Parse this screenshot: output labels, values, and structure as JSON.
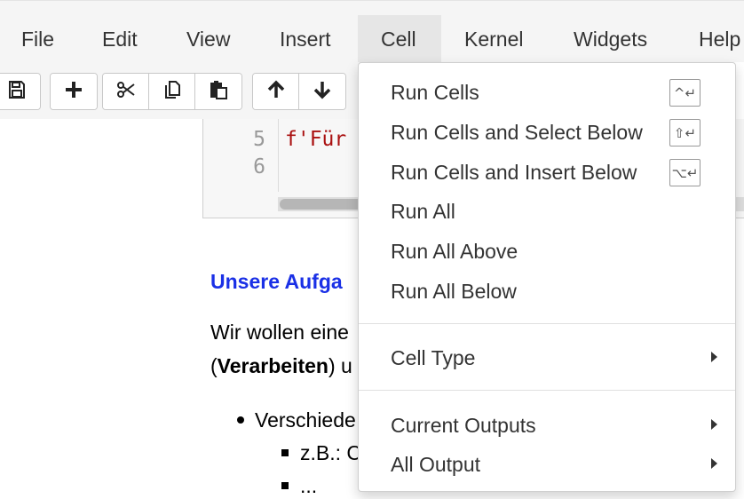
{
  "menubar": {
    "items": [
      {
        "label": "File"
      },
      {
        "label": "Edit"
      },
      {
        "label": "View"
      },
      {
        "label": "Insert"
      },
      {
        "label": "Cell"
      },
      {
        "label": "Kernel"
      },
      {
        "label": "Widgets"
      },
      {
        "label": "Help"
      }
    ],
    "active_item": "Cell"
  },
  "toolbar": {
    "buttons": [
      {
        "icon": "save-icon"
      },
      {
        "icon": "plus-icon"
      },
      {
        "icon": "scissors-icon"
      },
      {
        "icon": "copy-icon"
      },
      {
        "icon": "paste-icon"
      },
      {
        "icon": "arrow-up-icon"
      },
      {
        "icon": "arrow-down-icon"
      }
    ]
  },
  "code_cell": {
    "line_numbers": [
      "5",
      "6"
    ],
    "lines": [
      "f'Für",
      ""
    ]
  },
  "markdown": {
    "heading": "Unsere Aufga",
    "para1": "Wir wollen eine",
    "para2_open": "(",
    "para2_bold": "Verarbeiten",
    "para2_rest": ") u",
    "bullet1": "Verschiede",
    "subbullet1": "z.B.: C",
    "subbullet2": "..."
  },
  "dropdown": {
    "items": [
      {
        "label": "Run Cells",
        "shortcut": "^↵"
      },
      {
        "label": "Run Cells and Select Below",
        "shortcut": "⇧↵"
      },
      {
        "label": "Run Cells and Insert Below",
        "shortcut": "⌥↵"
      },
      {
        "label": "Run All"
      },
      {
        "label": "Run All Above"
      },
      {
        "label": "Run All Below"
      },
      {
        "label": "Cell Type",
        "submenu": true
      },
      {
        "label": "Current Outputs",
        "submenu": true
      },
      {
        "label": "All Output",
        "submenu": true
      }
    ]
  },
  "colors": {
    "menubar_bg": "#f5f5f5",
    "active_menu_bg": "#e6e6e6",
    "heading_blue": "#1a30e6",
    "code_string_red": "#a11"
  }
}
